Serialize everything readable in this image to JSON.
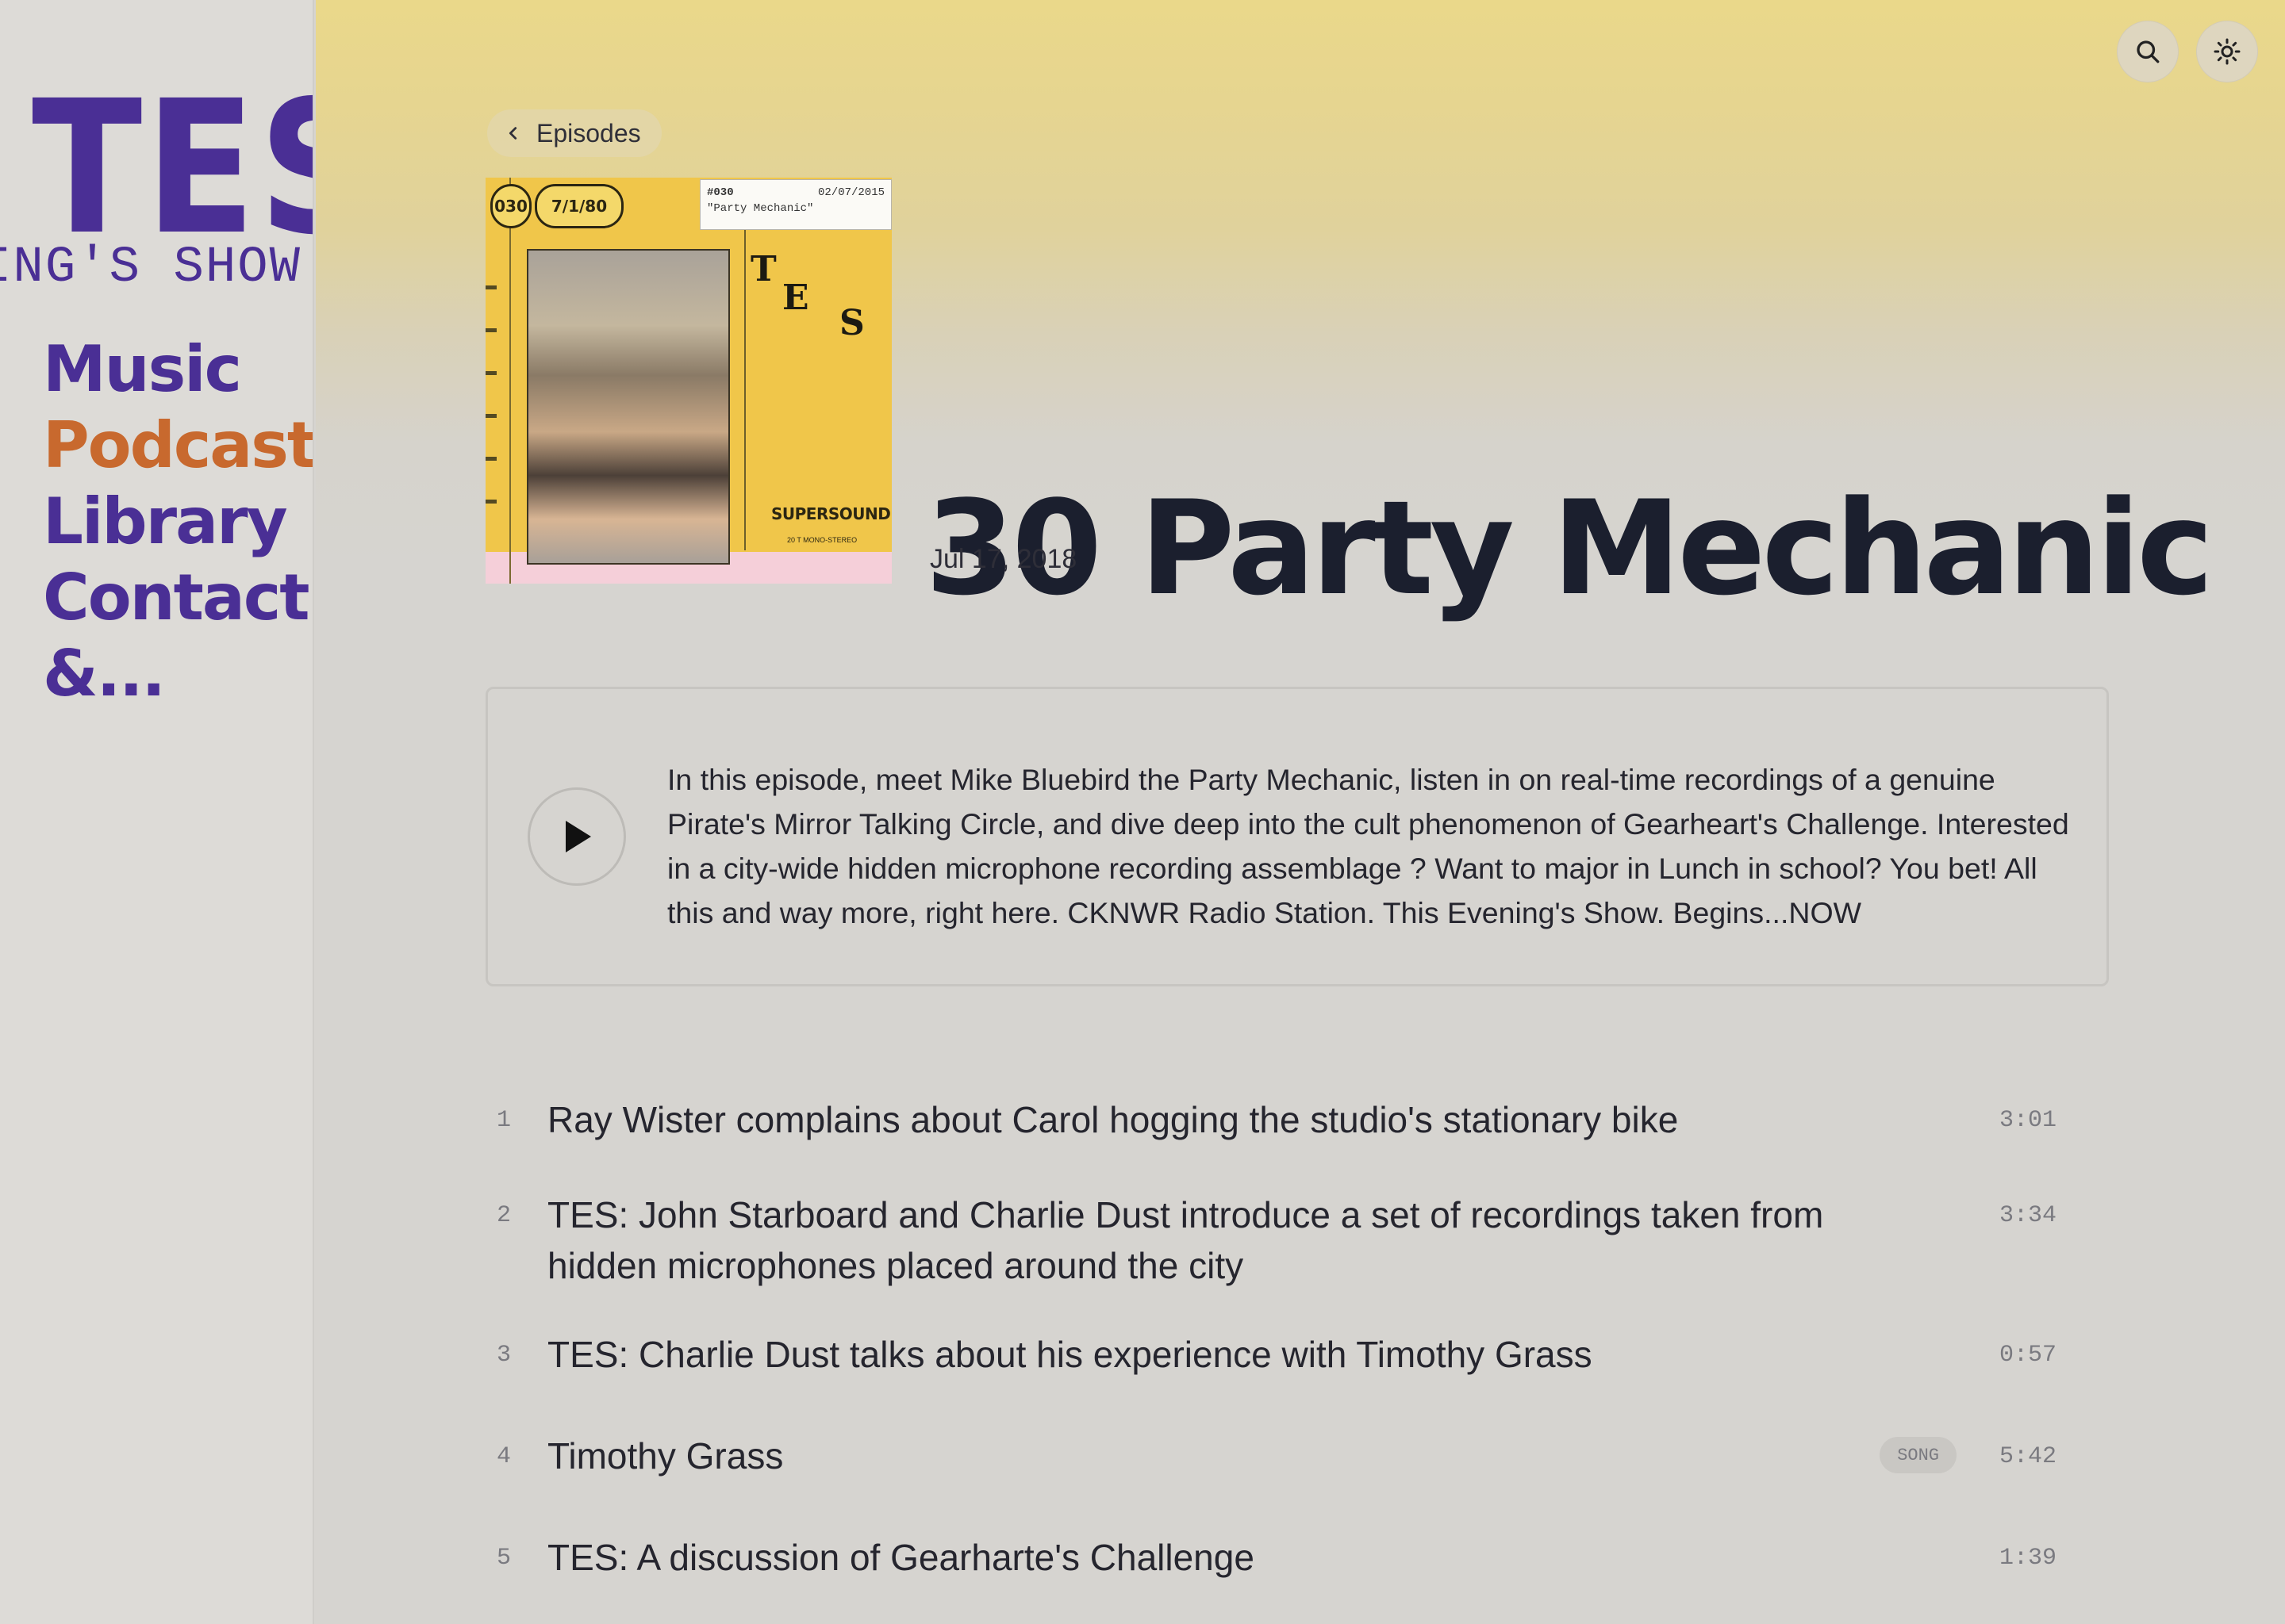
{
  "sidebar": {
    "logo_main": "TES",
    "logo_sub": "ING'S SHOW",
    "nav": [
      {
        "label": "Music",
        "active": false
      },
      {
        "label": "Podcast",
        "active": true
      },
      {
        "label": "Library",
        "active": false
      },
      {
        "label": "Contact",
        "active": false
      },
      {
        "label": "&...",
        "active": false
      }
    ]
  },
  "header": {
    "icons": [
      "search-icon",
      "sun-icon"
    ],
    "back_label": "Episodes"
  },
  "cover": {
    "episode_number": "030",
    "date": "7/1/80",
    "ticket_code": "#030",
    "ticket_date": "02/07/2015",
    "ticket_title": "\"Party Mechanic\"",
    "logo_letters": [
      "T",
      "E",
      "S"
    ],
    "brand": "SUPERSOUND",
    "fine_print": "20 T MONO-STEREO"
  },
  "episode": {
    "title": "30 Party Mechanic",
    "date": "Jul 17, 2018",
    "description": "In this episode, meet Mike Bluebird the Party Mechanic, listen in on real-time recordings of a genuine Pirate's Mirror Talking Circle, and dive deep into the cult phenomenon of Gearheart's Challenge. Interested in a city-wide hidden microphone recording assemblage ? Want to major in Lunch in school? You bet! All this and way more, right here. CKNWR Radio Station. This Evening's Show. Begins...NOW"
  },
  "tracks": [
    {
      "num": "1",
      "title": "Ray Wister complains about Carol hogging the studio's stationary bike",
      "duration": "3:01",
      "badge": null
    },
    {
      "num": "2",
      "title": "TES: John Starboard and Charlie Dust introduce a set of recordings taken from hidden microphones placed around the city",
      "duration": "3:34",
      "badge": null
    },
    {
      "num": "3",
      "title": "TES: Charlie Dust talks about his experience with Timothy Grass",
      "duration": "0:57",
      "badge": null
    },
    {
      "num": "4",
      "title": "Timothy Grass",
      "duration": "5:42",
      "badge": "SONG"
    },
    {
      "num": "5",
      "title": "TES: A discussion of Gearharte's Challenge",
      "duration": "1:39",
      "badge": null
    }
  ]
}
